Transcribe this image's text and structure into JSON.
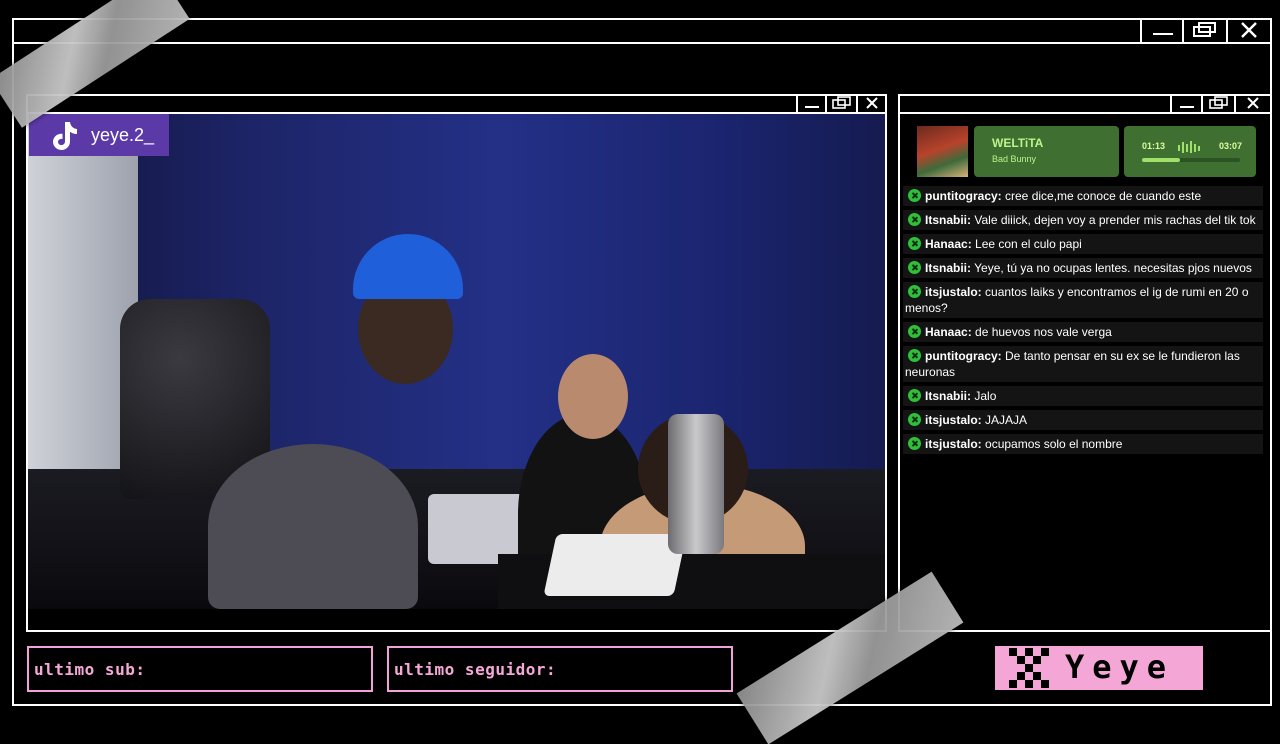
{
  "overlay": {
    "outer_window_controls": [
      "minimize-icon",
      "restore-icon",
      "close-icon"
    ],
    "video_window_controls": [
      "minimize-icon",
      "restore-icon",
      "close-icon"
    ],
    "chat_window_controls": [
      "minimize-icon",
      "restore-icon",
      "close-icon"
    ]
  },
  "stream": {
    "platform_icon": "tiktok-icon",
    "handle": "yeye.2_"
  },
  "now_playing": {
    "title": "WELTiTA",
    "artist": "Bad Bunny",
    "current_time": "01:13",
    "total_time": "03:07",
    "progress": 0.39
  },
  "chat": {
    "messages": [
      {
        "user": "puntitogracy:",
        "text": "cree dice,me conoce de cuando este"
      },
      {
        "user": "Itsnabii:",
        "text": "Vale diiick, dejen voy a prender mis rachas del tik tok"
      },
      {
        "user": "Hanaac:",
        "text": "Lee con el culo papi"
      },
      {
        "user": "Itsnabii:",
        "text": "Yeye, tú ya no ocupas lentes. necesitas pjos nuevos"
      },
      {
        "user": "itsjustalo:",
        "text": "cuantos laiks y encontramos el ig de rumi en 20 o menos?"
      },
      {
        "user": "Hanaac:",
        "text": "de huevos nos vale verga"
      },
      {
        "user": "puntitogracy:",
        "text": "De tanto pensar en su ex se le fundieron las neuronas"
      },
      {
        "user": "Itsnabii:",
        "text": "Jalo"
      },
      {
        "user": "itsjustalo:",
        "text": "JAJAJA"
      },
      {
        "user": "itsjustalo:",
        "text": "ocupamos solo el nombre"
      }
    ]
  },
  "bottom": {
    "last_sub_label": "ultimo sub:",
    "last_follower_label": "ultimo seguidor:",
    "logo_text": "Yeye"
  },
  "colors": {
    "accent_pink": "#f4a6d6",
    "badge_purple": "#5b3aa8",
    "player_green": "#3f6f31",
    "chat_badge_green": "#2fbf3a"
  }
}
